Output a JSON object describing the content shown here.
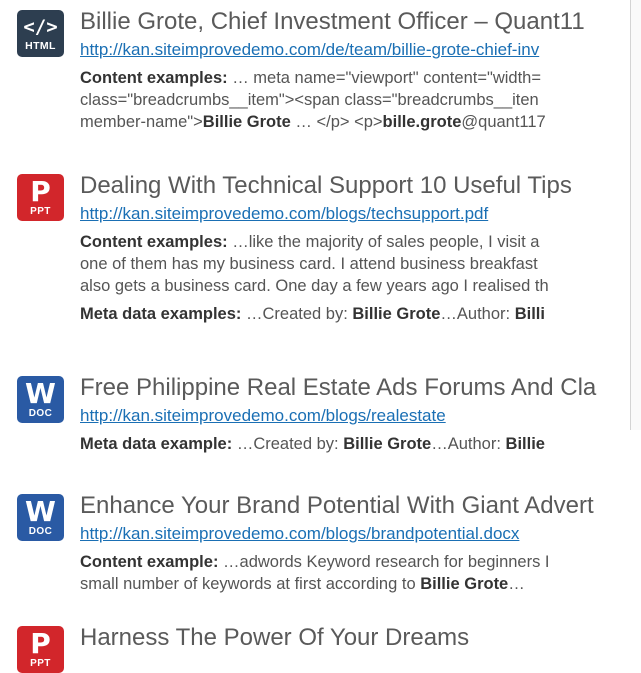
{
  "results": [
    {
      "icon": {
        "type": "html-icon",
        "glyph": "</>",
        "ext": "HTML",
        "color": "#2d3e50"
      },
      "title": "Billie Grote, Chief Investment Officer – Quant11",
      "url": "http://kan.siteimprovedemo.com/de/team/billie-grote-chief-inv",
      "content_label": "Content examples:",
      "content_lines": [
        {
          "a": " … meta name=\"viewport\" content=\"width="
        },
        {
          "a": "class=\"breadcrumbs__item\"><span class=\"breadcrumbs__iten"
        },
        {
          "a": "member-name\">",
          "b": "Billie Grote",
          "c": " … </p> <p>",
          "d": "bille.grote",
          "e": "@quant117"
        }
      ]
    },
    {
      "icon": {
        "type": "ppt-icon",
        "glyph": "P",
        "ext": "PPT",
        "color": "#d2262b"
      },
      "title": "Dealing With Technical Support 10 Useful Tips",
      "url": "http://kan.siteimprovedemo.com/blogs/techsupport.pdf",
      "content_label": "Content examples:",
      "content_lines": [
        {
          "a": " …like the majority of sales people, I visit a"
        },
        {
          "a": "one of them has my business card. I attend business breakfast"
        },
        {
          "a": "also gets a business card. One day a few years ago I realised th"
        }
      ],
      "meta_label": "Meta data examples:",
      "meta": {
        "a": " …Created by: ",
        "b": "Billie Grote",
        "c": "…Author: ",
        "d": "Billi"
      }
    },
    {
      "icon": {
        "type": "doc-icon",
        "glyph": "W",
        "ext": "DOC",
        "color": "#2a5aa4"
      },
      "title": "Free Philippine Real Estate Ads Forums And Cla",
      "url": "http://kan.siteimprovedemo.com/blogs/realestate",
      "meta_label": "Meta data example:",
      "meta": {
        "a": " …Created by: ",
        "b": "Billie Grote",
        "c": "…Author: ",
        "d": "Billie"
      }
    },
    {
      "icon": {
        "type": "doc-icon",
        "glyph": "W",
        "ext": "DOC",
        "color": "#2a5aa4"
      },
      "title": "Enhance Your Brand Potential With Giant Advert",
      "url": "http://kan.siteimprovedemo.com/blogs/brandpotential.docx",
      "content_label": "Content example:",
      "content_lines": [
        {
          "a": " …adwords Keyword research for beginners I"
        },
        {
          "a": "small number of keywords at first according to ",
          "b": "Billie Grote",
          "c": "…"
        }
      ]
    },
    {
      "icon": {
        "type": "ppt-icon",
        "glyph": "P",
        "ext": "PPT",
        "color": "#d2262b"
      },
      "title": "Harness The Power Of Your Dreams"
    }
  ]
}
